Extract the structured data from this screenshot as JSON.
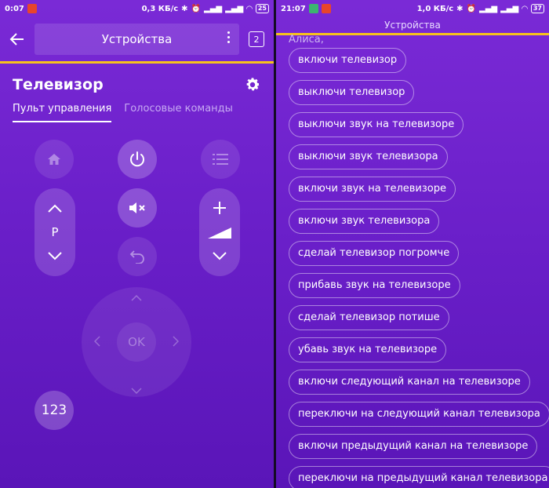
{
  "left": {
    "status": {
      "time": "0:07",
      "net_speed": "0,3 КБ/с",
      "battery": "25"
    },
    "appbar": {
      "title": "Устройства",
      "counter": "2"
    },
    "device": {
      "title": "Телевизор"
    },
    "tabs": [
      {
        "label": "Пульт управления"
      },
      {
        "label": "Голосовые команды"
      }
    ],
    "remote": {
      "channel_label": "P",
      "ok_label": "OK",
      "number_label": "123",
      "icons": [
        "home-icon",
        "power-icon",
        "menu-list-icon",
        "mute-icon",
        "undo-icon",
        "plus-icon",
        "volume-icon",
        "minus-icon"
      ]
    },
    "colors": {
      "accent_line": "#f7c21b",
      "notif_badge": "#e8452c"
    }
  },
  "right": {
    "status": {
      "time": "21:07",
      "net_speed": "1,0 КБ/с",
      "battery": "37"
    },
    "title": "Устройства",
    "prefix": "Алиса,",
    "commands": [
      "включи телевизор",
      "выключи телевизор",
      "выключи звук на телевизоре",
      "выключи звук телевизора",
      "включи звук на телевизоре",
      "включи звук телевизора",
      "сделай телевизор погромче",
      "прибавь звук на телевизоре",
      "сделай телевизор потише",
      "убавь звук на телевизоре",
      "включи следующий канал на телевизоре",
      "переключи на следующий канал телевизора",
      "включи предыдущий канал на телевизоре",
      "переключи на предыдущий канал телевизора"
    ],
    "colors": {
      "accent_line": "#f7c21b",
      "notif_green": "#3cb371",
      "notif_badge": "#e8452c"
    }
  }
}
